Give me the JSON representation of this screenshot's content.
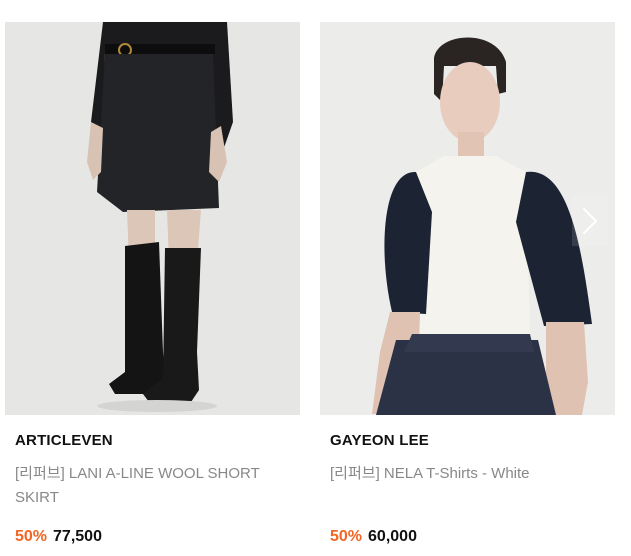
{
  "products": [
    {
      "brand": "ARTICLEVEN",
      "title": "[리퍼브] LANI A-LINE WOOL SHORT SKIRT",
      "discount": "50%",
      "price": "77,500"
    },
    {
      "brand": "GAYEON LEE",
      "title": "[리퍼브] NELA T-Shirts - White",
      "discount": "50%",
      "price": "60,000"
    }
  ],
  "carousel": {
    "next_icon": "chevron-right-icon"
  },
  "colors": {
    "discount": "#f26522",
    "brand_text": "#111111",
    "title_text": "#888888",
    "photo_bg": "#e9e9e7"
  }
}
